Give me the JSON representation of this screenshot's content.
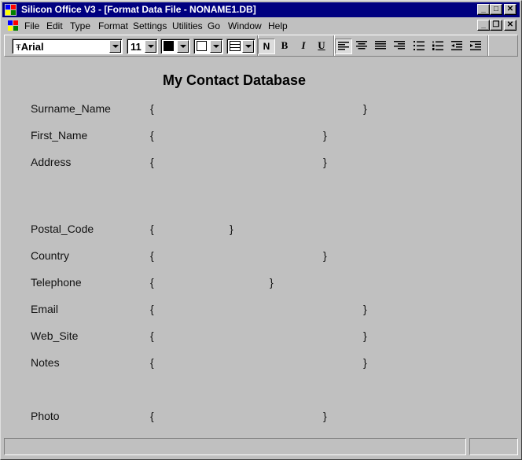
{
  "app": {
    "title": "Silicon Office V3 - [Format Data File - NONAME1.DB]"
  },
  "menu": [
    "File",
    "Edit",
    "Type",
    "Format",
    "Settings",
    "Utilities",
    "Go",
    "Window",
    "Help"
  ],
  "toolbar": {
    "font_name": "Arial",
    "font_size": "11",
    "normal_label": "N",
    "bold_label": "B",
    "italic_label": "I",
    "underline_label": "U",
    "text_color": "#000000",
    "fill_color": "#ffffff"
  },
  "document": {
    "title": "My Contact Database",
    "fields": [
      {
        "label": "Surname_Name",
        "open": "{",
        "close": "}"
      },
      {
        "label": "First_Name",
        "open": "{",
        "close": "}"
      },
      {
        "label": "Address",
        "open": "{",
        "close": "}"
      },
      {
        "label": "Postal_Code",
        "open": "{",
        "close": "}"
      },
      {
        "label": "Country",
        "open": "{",
        "close": "}"
      },
      {
        "label": "Telephone",
        "open": "{",
        "close": "}"
      },
      {
        "label": "Email",
        "open": "{",
        "close": "}"
      },
      {
        "label": "Web_Site",
        "open": "{",
        "close": "}"
      },
      {
        "label": "Notes",
        "open": "{",
        "close": "}"
      },
      {
        "label": "Photo",
        "open": "{",
        "close": "}"
      }
    ]
  },
  "colors": {
    "titlebar": "#000080",
    "face": "#c0c0c0"
  }
}
